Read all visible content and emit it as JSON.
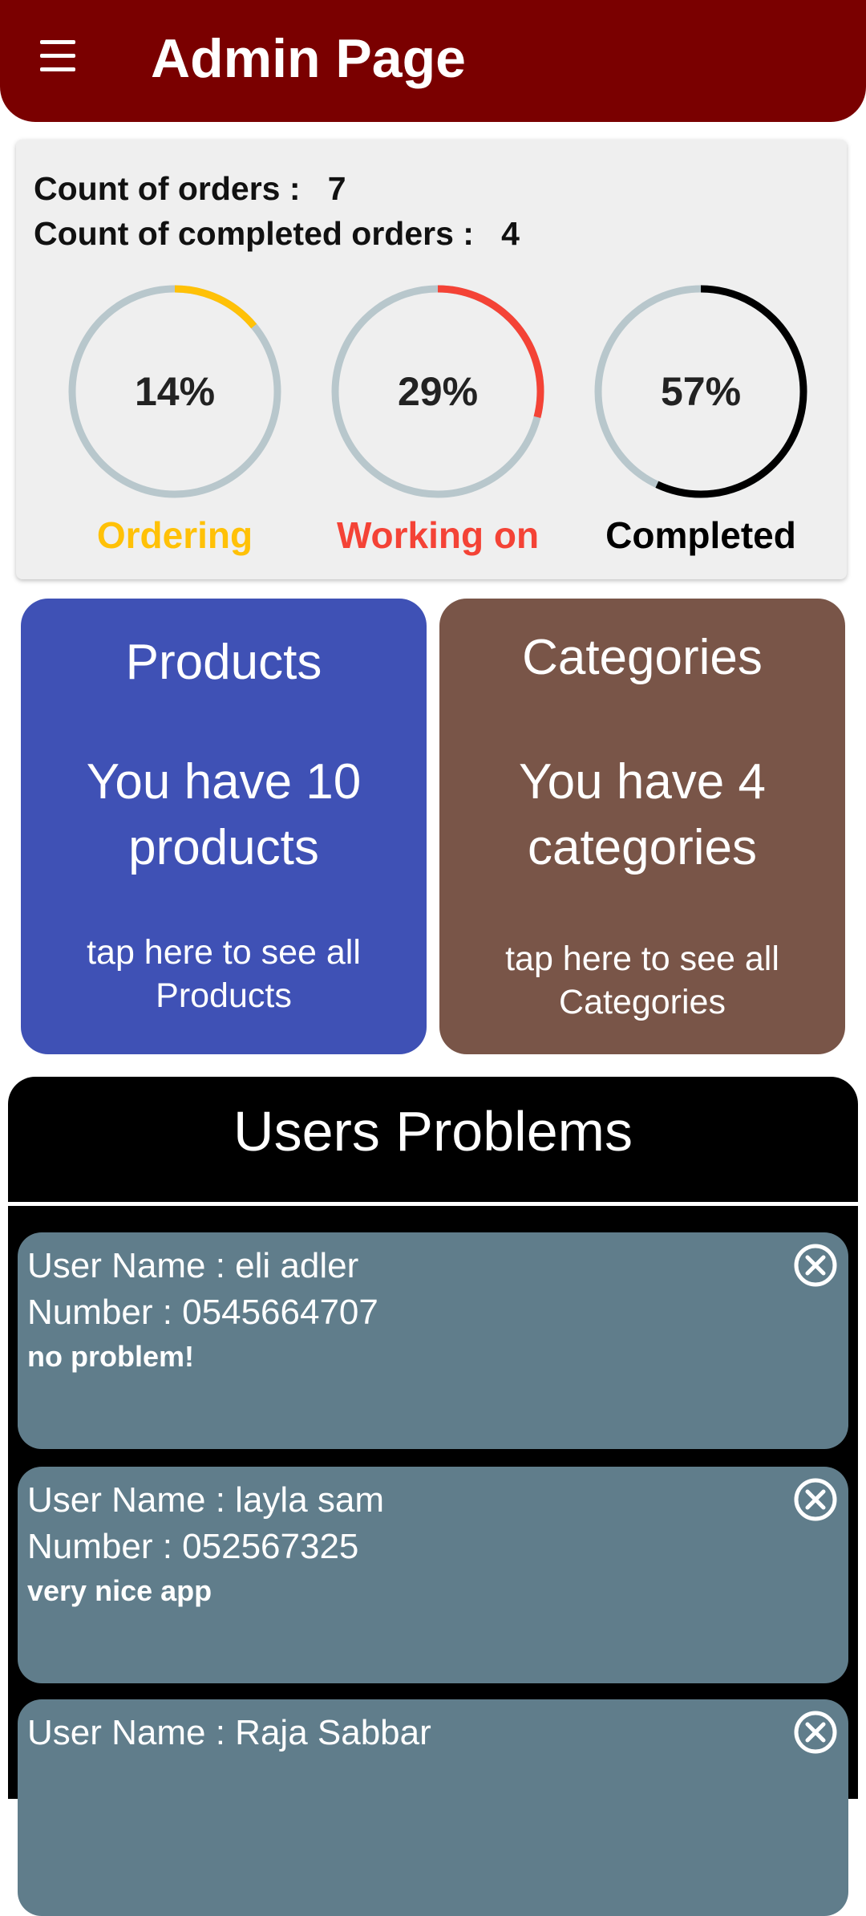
{
  "header": {
    "title": "Admin Page",
    "menu_icon": "hamburger-menu-icon"
  },
  "stats": {
    "orders_label": "Count of orders :",
    "orders_count": "7",
    "completed_label": "Count of completed orders :",
    "completed_count": "4",
    "rings": [
      {
        "percent_text": "14%",
        "value": 0.14,
        "label": "Ordering",
        "color": "#ffc107"
      },
      {
        "percent_text": "29%",
        "value": 0.29,
        "label": "Working on",
        "color": "#f44336"
      },
      {
        "percent_text": "57%",
        "value": 0.57,
        "label": "Completed",
        "color": "#000000"
      }
    ],
    "track_color": "#b8c7cc"
  },
  "tiles": {
    "products": {
      "title": "Products",
      "count_text": "You have 10 products",
      "hint": "tap here to see all Products",
      "color": "#3f51b5"
    },
    "categories": {
      "title": "Categories",
      "count_text": "You have 4 categories",
      "hint": "tap here to see all Categories",
      "color": "#795548"
    }
  },
  "problems": {
    "title": "Users Problems",
    "items": [
      {
        "name": "User Name : eli adler",
        "number": "Number : 0545664707",
        "message": "no problem!",
        "close_icon": "close-circle-icon"
      },
      {
        "name": "User Name : layla sam",
        "number": "Number : 052567325",
        "message": "very nice app",
        "close_icon": "close-circle-icon"
      },
      {
        "name": "User Name : Raja Sabbar",
        "number": "",
        "message": "",
        "close_icon": "close-circle-icon"
      }
    ]
  }
}
